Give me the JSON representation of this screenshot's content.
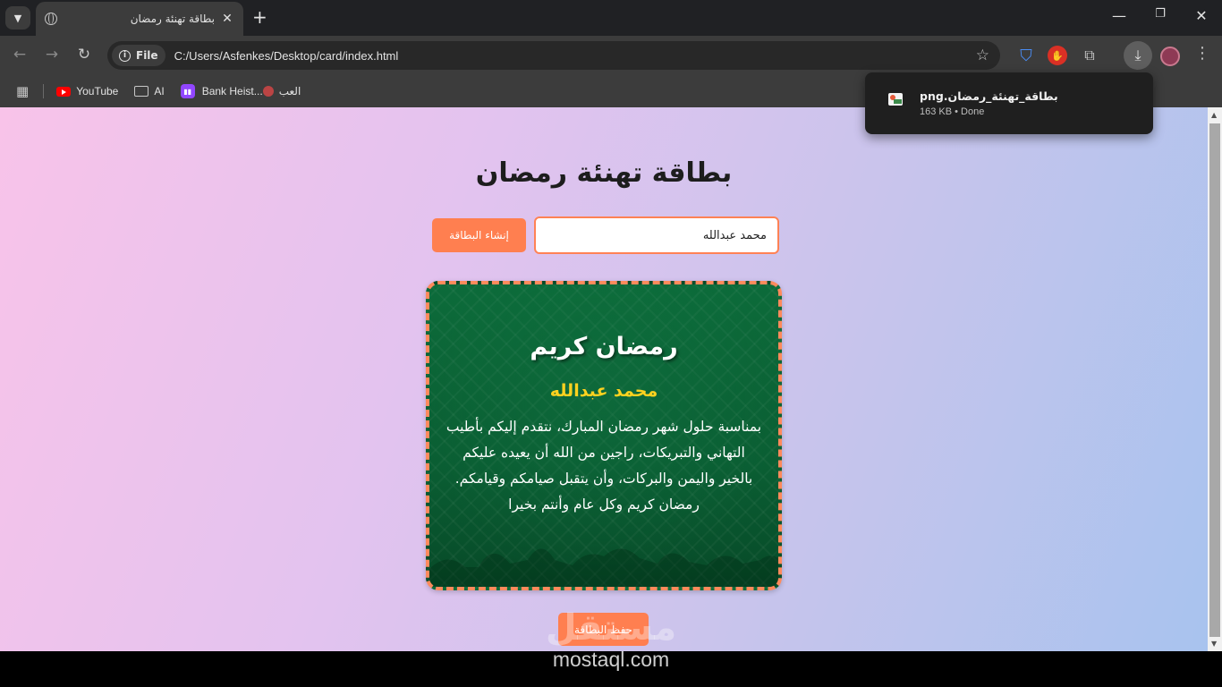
{
  "browser": {
    "tab_title": "بطاقة تهنئة رمضان",
    "url": "C:/Users/Asfenkes/Desktop/card/index.html",
    "site_chip": "File",
    "bookmarks": [
      {
        "label": "YouTube",
        "icon": "youtube-icon"
      },
      {
        "label": "AI",
        "icon": "folder-icon"
      },
      {
        "label": "Bank Heist...",
        "icon": "twitch-icon"
      },
      {
        "label": "العب",
        "icon": "game-icon"
      }
    ]
  },
  "download": {
    "filename": "png.بطاقة_تهنئة_رمضان",
    "status": "163 KB • Done"
  },
  "page": {
    "title": "بطاقة تهنئة رمضان",
    "name_input_value": "محمد عبدالله",
    "create_button": "إنشاء البطاقة",
    "save_button": "حفظ البطاقة"
  },
  "card": {
    "heading": "رمضان كريم",
    "name": "محمد عبدالله",
    "message": "بمناسبة حلول شهر رمضان المبارك، نتقدم إليكم بأطيب التهاني والتبريكات، راجين من الله أن يعيده عليكم بالخير واليمن والبركات، وأن يتقبل صيامكم وقيامكم. رمضان كريم وكل عام وأنتم بخيرا",
    "accent_color": "#ffd21f",
    "border_color": "#ff8a5c",
    "background_color": "#0a5e33"
  },
  "watermark": {
    "logo": "مستقل",
    "text": "mostaql.com"
  }
}
